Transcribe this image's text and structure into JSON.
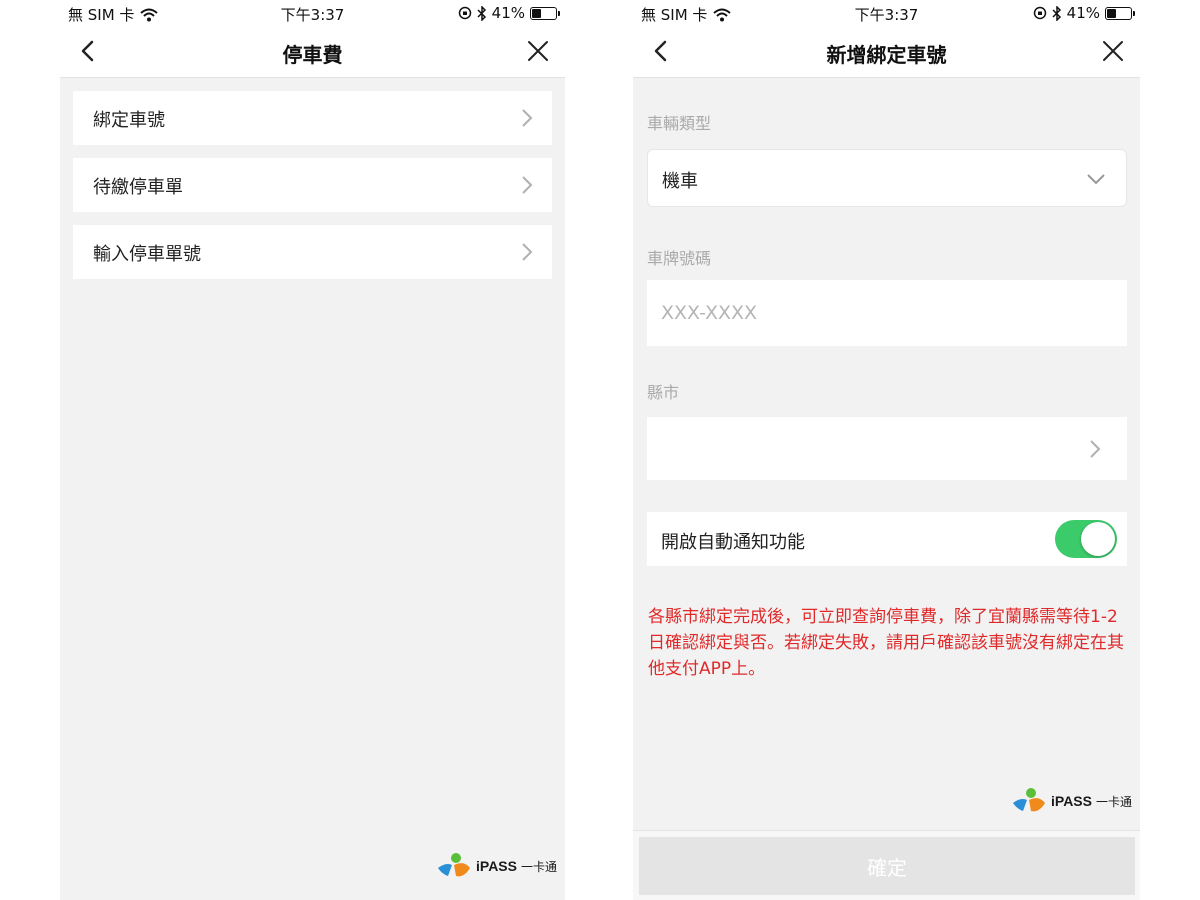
{
  "status_bar": {
    "carrier": "無 SIM 卡",
    "time": "下午3:37",
    "battery_percent": "41%",
    "battery_level": 0.41
  },
  "left_screen": {
    "title": "停車費",
    "menu_items": [
      {
        "label": "綁定車號"
      },
      {
        "label": "待繳停車單"
      },
      {
        "label": "輸入停車單號"
      }
    ]
  },
  "right_screen": {
    "title": "新增綁定車號",
    "vehicle_type_label": "車輛類型",
    "vehicle_type_value": "機車",
    "plate_label": "車牌號碼",
    "plate_placeholder": "XXX-XXXX",
    "plate_value": "",
    "county_label": "縣市",
    "county_value": "",
    "notify_label": "開啟自動通知功能",
    "notify_enabled": true,
    "notice": "各縣市綁定完成後，可立即查詢停車費，除了宜蘭縣需等待1-2日確認綁定與否。若綁定失敗，請用戶確認該車號沒有綁定在其他支付APP上。",
    "confirm_label": "確定"
  },
  "logo": {
    "brand": "iPASS",
    "sub": "一卡通"
  },
  "colors": {
    "toggle_on": "#3ccb6b",
    "notice_red": "#e02a2a",
    "logo_green": "#5cbf3a",
    "logo_blue": "#2a8fd6",
    "logo_orange": "#f08a1c"
  }
}
